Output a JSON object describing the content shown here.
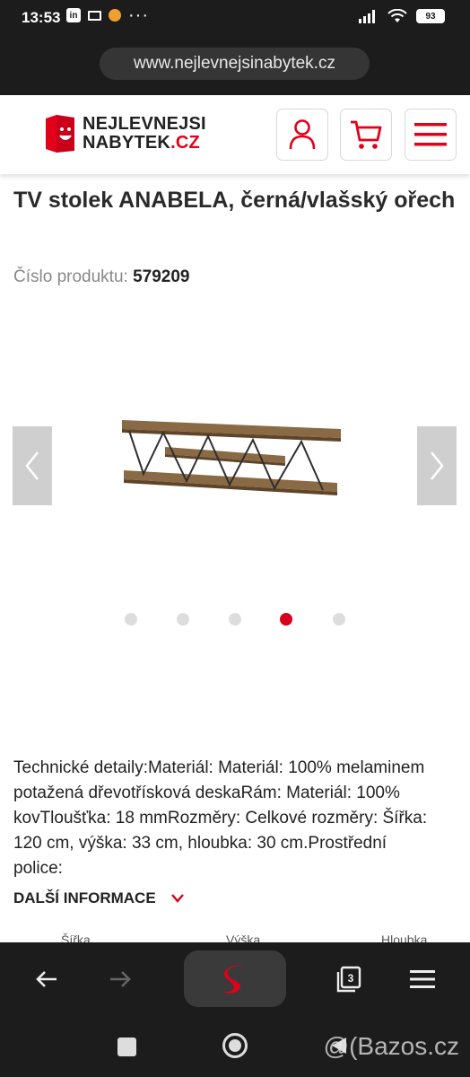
{
  "status": {
    "time": "13:53",
    "battery": "93",
    "app_badge": "in"
  },
  "browser": {
    "url": "www.nejlevnejsinabytek.cz",
    "tab_count": "3"
  },
  "brand": {
    "line1": "NEJLEVNEJSI",
    "line2_prefix": "NABYTEK",
    "line2_suffix": ".CZ",
    "accent": "#e2001a"
  },
  "product": {
    "title": "TV stolek ANABELA, černá/vlašský ořech",
    "number_label": "Číslo produktu:",
    "number": "579209",
    "carousel_count": 5,
    "carousel_active": 4,
    "description": "Technické detaily:Materiál: Materiál: 100% melaminem potažená dřevotřísková deskaRám: Materiál: 100% kovTloušťka: 18 mmRozměry: Celkové rozměry: Šířka: 120 cm, výška: 33 cm, hloubka: 30 cm.Prostřední police:",
    "more_label": "DALŠÍ INFORMACE",
    "dims": [
      "Šířka",
      "Výška",
      "Hloubka"
    ]
  },
  "icons": {
    "header": [
      "user-icon",
      "cart-icon",
      "menu-icon"
    ],
    "carousel": [
      "chevron-left-icon",
      "chevron-right-icon"
    ],
    "bottom": [
      "back-arrow-icon",
      "forward-arrow-icon",
      "seznam-s-icon",
      "tabs-icon",
      "hamburger-icon"
    ]
  },
  "watermark": "@(Bazos.cz"
}
